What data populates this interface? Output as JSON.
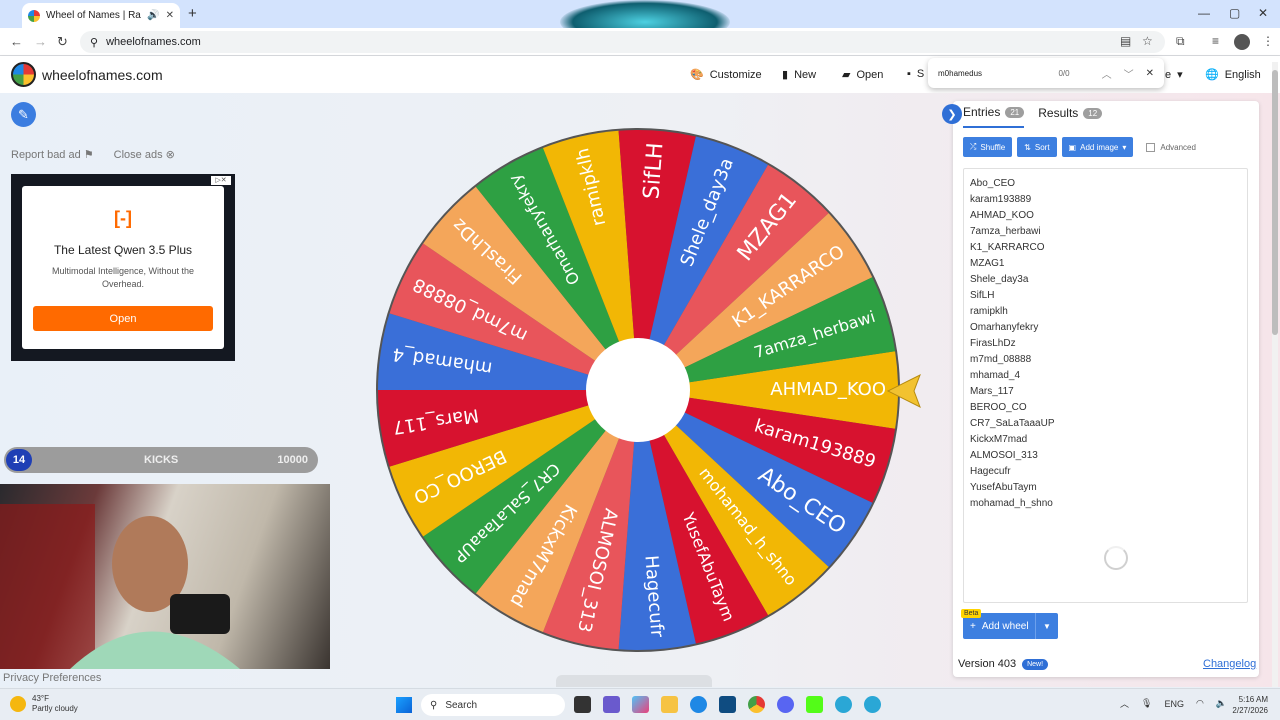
{
  "browser": {
    "tab_title": "Wheel of Names | Random",
    "url": "wheelofnames.com"
  },
  "site": {
    "name": "wheelofnames.com",
    "menu": {
      "customize": "Customize",
      "new": "New",
      "open": "Open",
      "save": "S",
      "share": "e",
      "language": "English"
    }
  },
  "find": {
    "query": "m0hamedus",
    "count": "0/0"
  },
  "ad": {
    "report": "Report bad ad",
    "close": "Close ads",
    "title": "The Latest Qwen 3.5 Plus",
    "subtitle": "Multimodal Intelligence, Without the Overhead.",
    "button": "Open"
  },
  "kicks": {
    "count": "14",
    "label": "KICKS",
    "value": "10000"
  },
  "privacy": "Privacy Preferences",
  "panel": {
    "tab_entries": "Entries",
    "entries_count": "21",
    "tab_results": "Results",
    "results_count": "12",
    "shuffle": "Shuffle",
    "sort": "Sort",
    "add_image": "Add image",
    "advanced": "Advanced",
    "add_wheel": "Add wheel",
    "beta": "Beta",
    "version": "Version 403",
    "new_badge": "New!",
    "changelog": "Changelog"
  },
  "entries": [
    "Abo_CEO",
    "karam193889",
    "AHMAD_KOO",
    "7amza_herbawi",
    "K1_KARRARCO",
    "MZAG1",
    "Shele_day3a",
    "SifLH",
    "ramipklh",
    "Omarhanyfekry",
    "FirasLhDz",
    "m7md_08888",
    "mhamad_4",
    "Mars_117",
    "BEROO_CO",
    "CR7_SaLaTaaaUP",
    "KickxM7mad",
    "ALMOSOI_313",
    "Hagecufr",
    "YusefAbuTaym",
    "mohamad_h_shno"
  ],
  "wheel": {
    "segments": [
      {
        "label": "AHMAD_KOO",
        "color": "#f2b705"
      },
      {
        "label": "karam193889",
        "color": "#d7122f"
      },
      {
        "label": "Abo_CEO",
        "color": "#3a6fd8"
      },
      {
        "label": "mohamad_h_shno",
        "color": "#f2b705"
      },
      {
        "label": "YusefAbuTaym",
        "color": "#d7122f"
      },
      {
        "label": "Hagecufr",
        "color": "#3a6fd8"
      },
      {
        "label": "ALMOSOI_313",
        "color": "#e8555b"
      },
      {
        "label": "KickxM7mad",
        "color": "#f4a65a"
      },
      {
        "label": "CR7_SaLaTaaaUP",
        "color": "#2ea043"
      },
      {
        "label": "BEROO_CO",
        "color": "#f2b705"
      },
      {
        "label": "Mars_117",
        "color": "#d7122f"
      },
      {
        "label": "mhamad_4",
        "color": "#3a6fd8"
      },
      {
        "label": "m7md_08888",
        "color": "#e8555b"
      },
      {
        "label": "FirasLhDz",
        "color": "#f4a65a"
      },
      {
        "label": "Omarhanyfekry",
        "color": "#2ea043"
      },
      {
        "label": "ramipklh",
        "color": "#f2b705"
      },
      {
        "label": "SifLH",
        "color": "#d7122f"
      },
      {
        "label": "Shele_day3a",
        "color": "#3a6fd8"
      },
      {
        "label": "MZAG1",
        "color": "#e8555b"
      },
      {
        "label": "K1_KARRARCO",
        "color": "#f4a65a"
      },
      {
        "label": "7amza_herbawi",
        "color": "#2ea043"
      }
    ]
  },
  "taskbar": {
    "temp": "43°F",
    "weather": "Partly cloudy",
    "search": "Search",
    "lang": "ENG",
    "time": "5:16 AM",
    "date": "2/27/2026"
  }
}
